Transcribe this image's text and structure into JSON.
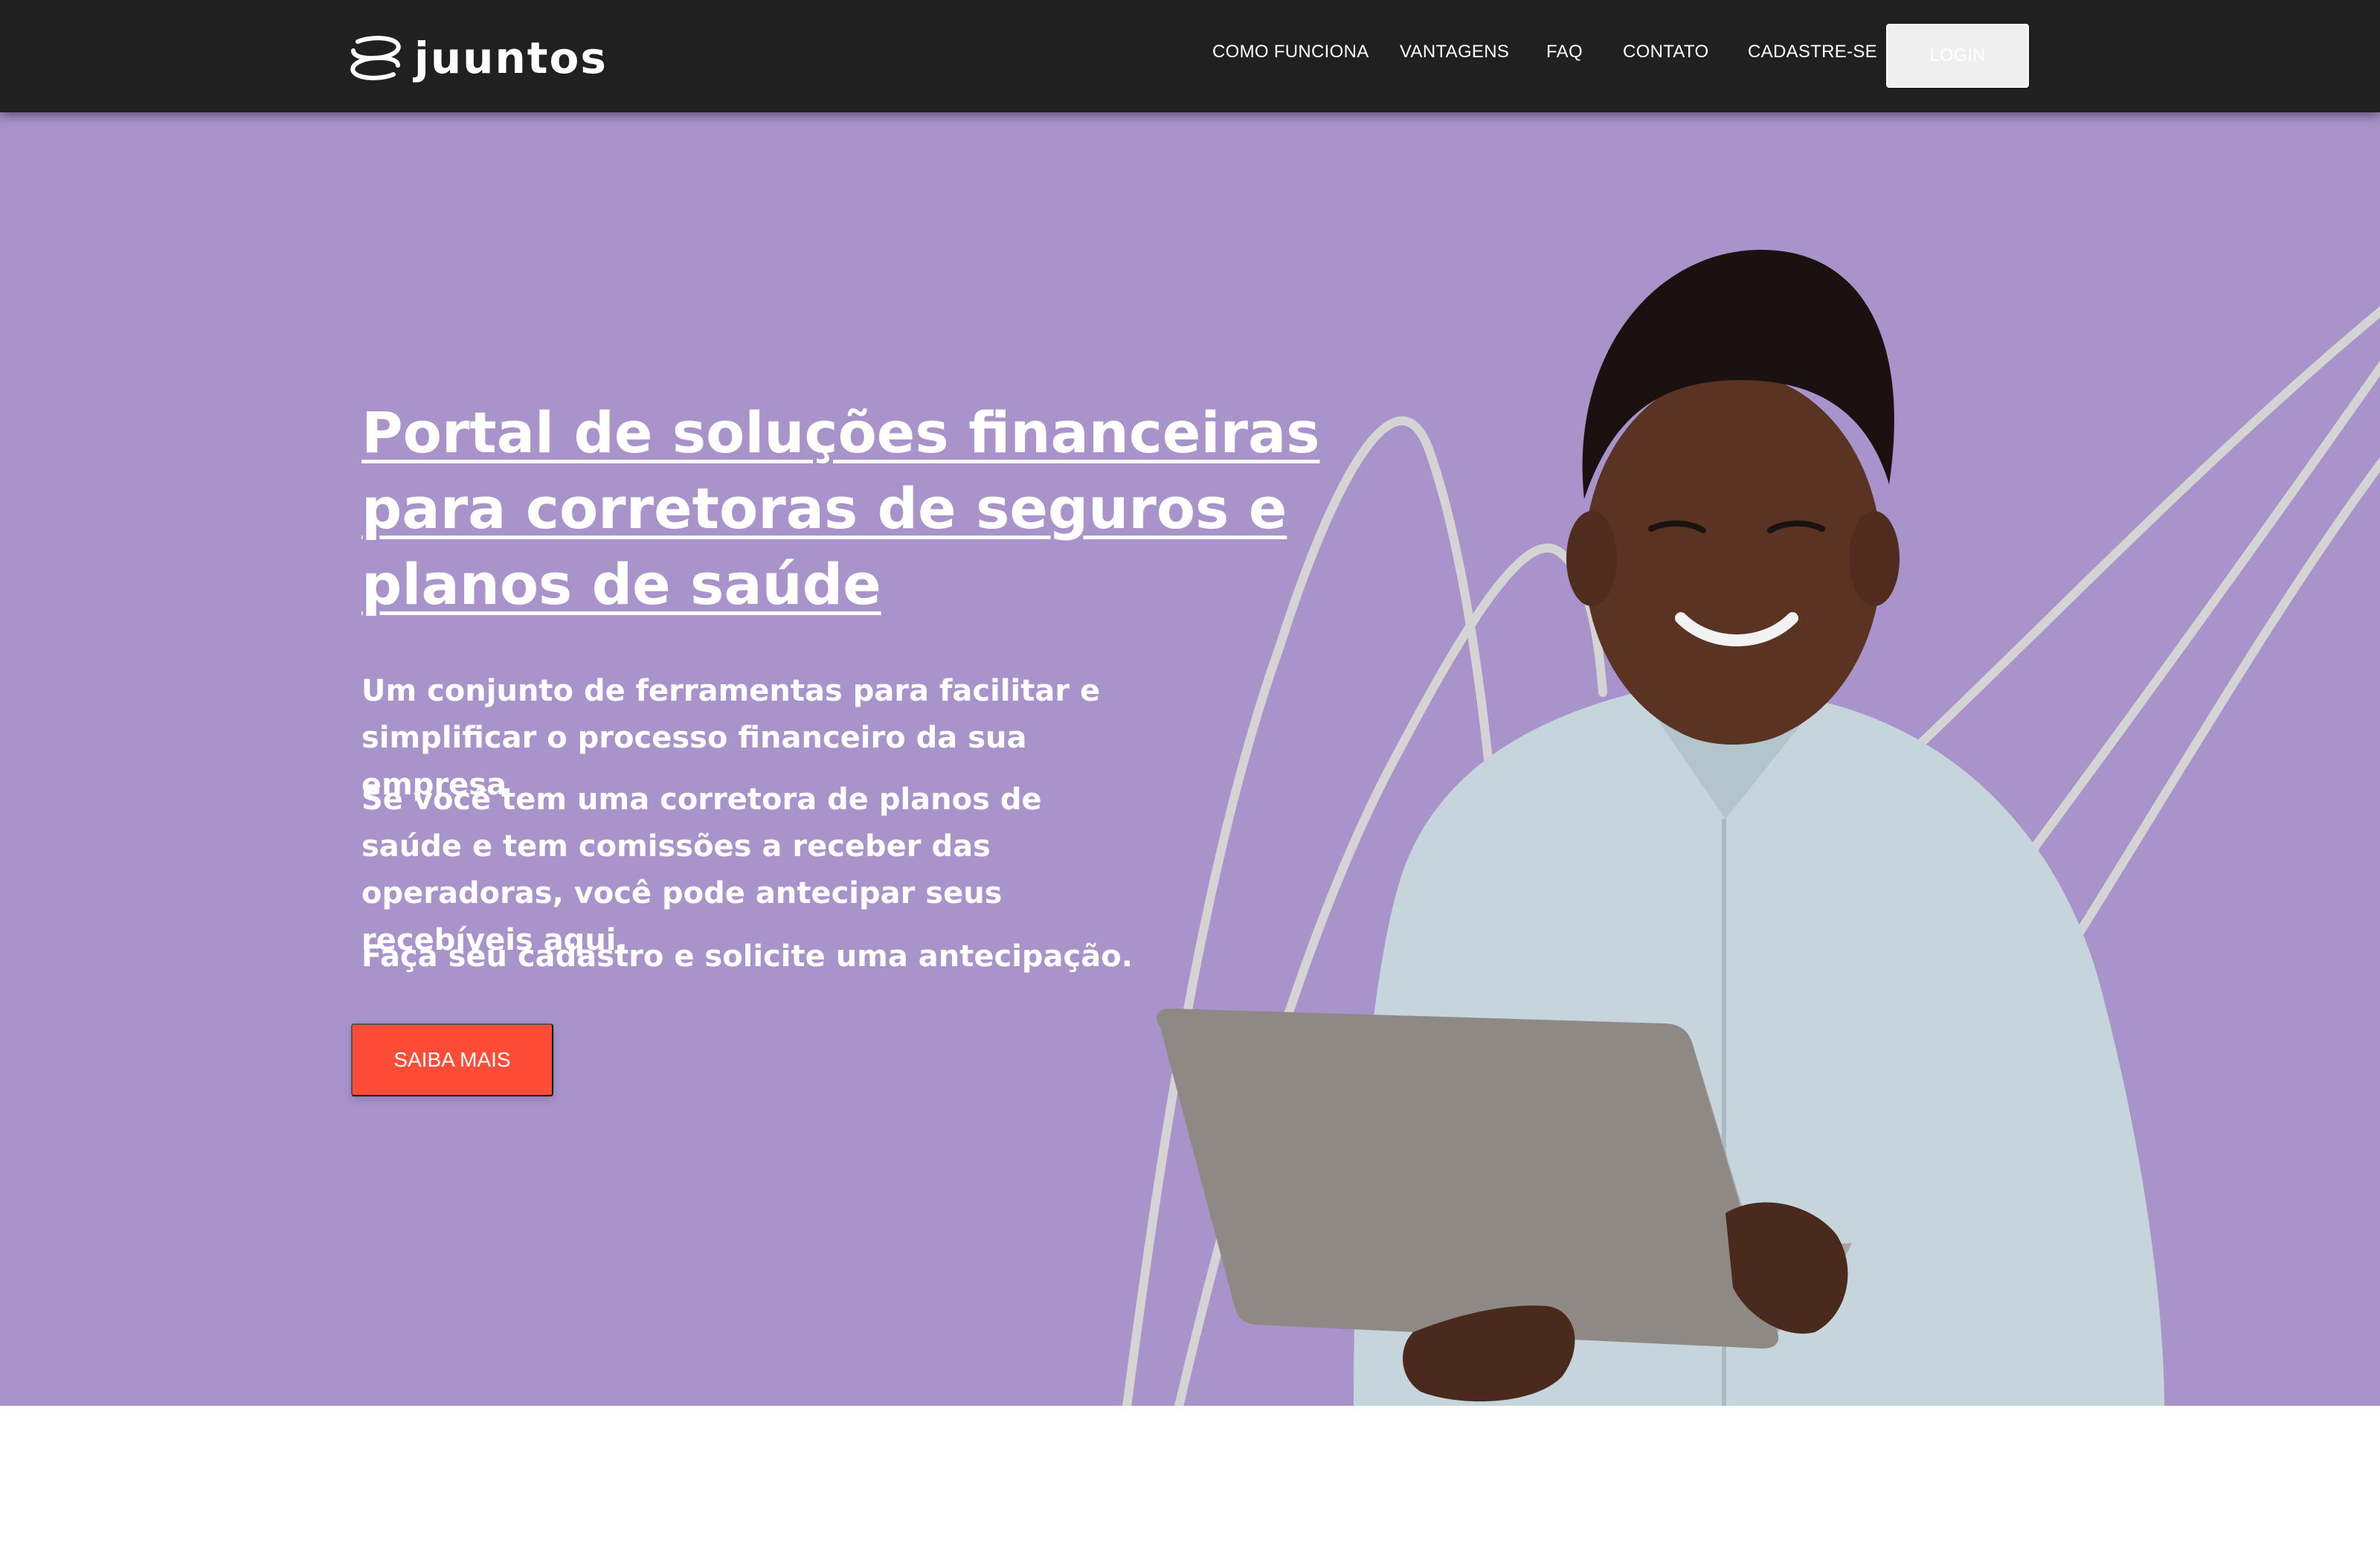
{
  "brand": {
    "name": "juuntos",
    "logo_icon": "juuntos-logo-icon"
  },
  "nav": {
    "items": [
      {
        "label": "COMO FUNCIONA"
      },
      {
        "label": "VANTAGENS"
      },
      {
        "label": "FAQ"
      },
      {
        "label": "CONTATO"
      },
      {
        "label": "CADASTRE-SE"
      }
    ],
    "login_label": "LOGIN"
  },
  "hero": {
    "title": "Portal de soluções financeiras para corretoras de seguros e planos de saúde",
    "paragraphs": [
      "Um conjunto de ferramentas para facilitar e simplificar o processo financeiro da sua empresa",
      "Se você tem uma corretora de planos de saúde e tem comissões a receber das operadoras, você pode antecipar seus recebíveis aqui.",
      "Faça seu cadastro e solicite uma antecipação."
    ],
    "cta_label": "SAIBA MAIS"
  },
  "colors": {
    "header_bg": "#202020",
    "hero_bg": "#a893ca",
    "cta_bg": "#fe4c36",
    "text_light": "#ffffff"
  }
}
